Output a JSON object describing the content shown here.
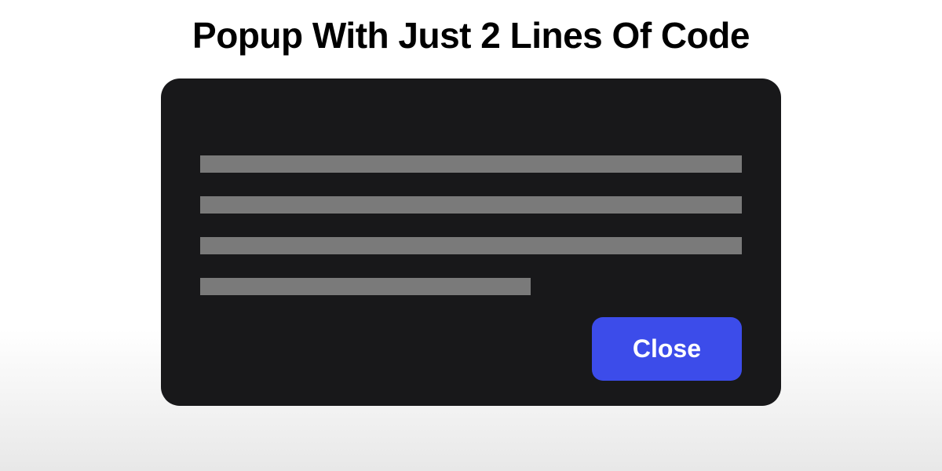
{
  "heading": "Popup With Just 2 Lines Of Code",
  "popup": {
    "close_label": "Close"
  },
  "colors": {
    "popup_bg": "#18181a",
    "button_bg": "#3c4cea",
    "placeholder": "#7a7a7a"
  }
}
